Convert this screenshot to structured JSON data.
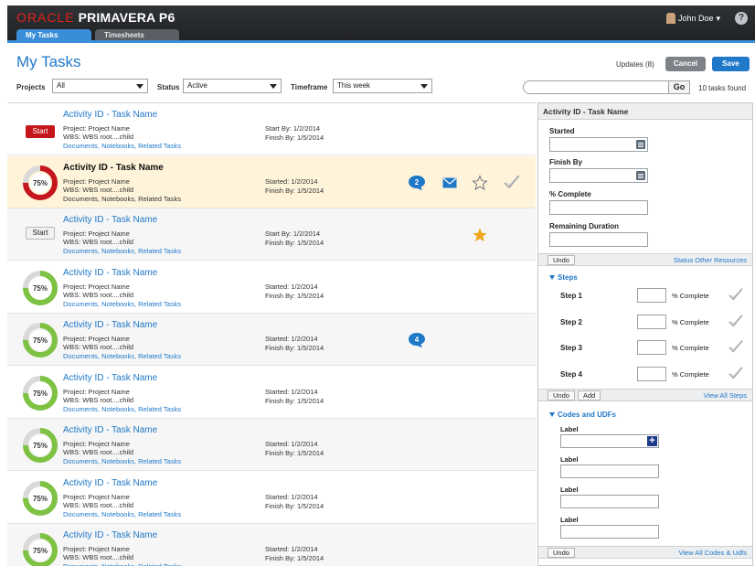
{
  "header": {
    "brand_oracle": "ORACLE",
    "brand_product": "PRIMAVERA P6",
    "user_name": "John Doe",
    "help": "?"
  },
  "tabs": [
    {
      "label": "My Tasks",
      "active": true
    },
    {
      "label": "Timesheets",
      "active": false
    }
  ],
  "page": {
    "title": "My Tasks",
    "updates": "Updates (8)",
    "cancel": "Cancel",
    "save": "Save"
  },
  "filters": {
    "projects_label": "Projects",
    "projects_value": "All",
    "status_label": "Status",
    "status_value": "Active",
    "timeframe_label": "Timeframe",
    "timeframe_value": "This week",
    "search_placeholder": "",
    "go": "Go",
    "found": "10 tasks found"
  },
  "tasks": [
    {
      "title": "Activity ID - Task Name",
      "project": "Project:  Project Name",
      "wbs": "WBS:  WBS root....child",
      "links": "Documents, Notebooks, Related Tasks",
      "d1": "Start By:   1/2/2014",
      "d2": "Finish By:  1/5/2014",
      "action": "Start",
      "progress": null
    },
    {
      "title": "Activity ID - Task Name",
      "project": "Project:  Project Name",
      "wbs": "WBS:  WBS root....child",
      "links": "Documents, Notebooks, Related Tasks",
      "d1": "Started:   1/2/2014",
      "d2": "Finish By:  1/5/2014",
      "progress": 0.75,
      "progress_label": "75%",
      "badge": "2"
    },
    {
      "title": "Activity ID - Task Name",
      "project": "Project:  Project Name",
      "wbs": "WBS:  WBS root....child",
      "links": "Documents, Notebooks, Related Tasks",
      "d1": "Start By:   1/2/2014",
      "d2": "Finish By:  1/5/2014",
      "action": "Start",
      "progress": null
    },
    {
      "title": "Activity ID - Task Name",
      "project": "Project:  Project Name",
      "wbs": "WBS:  WBS root....child",
      "links": "Documents, Notebooks, Related Tasks",
      "d1": "Started:   1/2/2014",
      "d2": "Finish By:  1/5/2014",
      "progress": 0.75,
      "progress_label": "75%"
    },
    {
      "title": "Activity ID - Task Name",
      "project": "Project:  Project Name",
      "wbs": "WBS:  WBS root....child",
      "links": "Documents, Notebooks, Related Tasks",
      "d1": "Started:   1/2/2014",
      "d2": "Finish By:  1/5/2014",
      "progress": 0.75,
      "progress_label": "75%",
      "badge": "4"
    },
    {
      "title": "Activity ID - Task Name",
      "project": "Project:  Project Name",
      "wbs": "WBS:  WBS root....child",
      "links": "Documents, Notebooks, Related Tasks",
      "d1": "Started:   1/2/2014",
      "d2": "Finish By:  1/5/2014",
      "progress": 0.75,
      "progress_label": "75%"
    },
    {
      "title": "Activity ID - Task Name",
      "project": "Project:  Project Name",
      "wbs": "WBS:  WBS root....child",
      "links": "Documents, Notebooks, Related Tasks",
      "d1": "Started:   1/2/2014",
      "d2": "Finish By:  1/5/2014",
      "progress": 0.75,
      "progress_label": "75%"
    },
    {
      "title": "Activity ID - Task Name",
      "project": "Project:  Project Name",
      "wbs": "WBS:  WBS root....child",
      "links": "Documents, Notebooks, Related Tasks",
      "d1": "Started:   1/2/2014",
      "d2": "Finish By:  1/5/2014",
      "progress": 0.75,
      "progress_label": "75%"
    },
    {
      "title": "Activity ID - Task Name",
      "project": "Project:  Project Name",
      "wbs": "WBS:  WBS root....child",
      "links": "Documents, Notebooks, Related Tasks",
      "d1": "Started:   1/2/2014",
      "d2": "Finish By:  1/5/2014",
      "progress": 0.75,
      "progress_label": "75%"
    }
  ],
  "panel": {
    "title": "Activity ID - Task Name",
    "started": "Started",
    "finish_by": "Finish By",
    "pct_complete": "% Complete",
    "remaining": "Remaining Duration",
    "undo": "Undo",
    "status_link": "Status Other Resources",
    "steps_title": "Steps",
    "steps": [
      "Step 1",
      "Step 2",
      "Step 3",
      "Step 4"
    ],
    "step_pct": "% Complete",
    "add": "Add",
    "view_steps": "View All Steps",
    "codes_title": "Codes and UDFs",
    "code_label": "Label",
    "view_codes": "View All Codes & Udfs"
  },
  "colors": {
    "accent": "#1f78c8",
    "ring_red": "#c4161c",
    "ring_green": "#7dc242",
    "selected_row": "#fff3d9",
    "star": "#f0a81c"
  }
}
